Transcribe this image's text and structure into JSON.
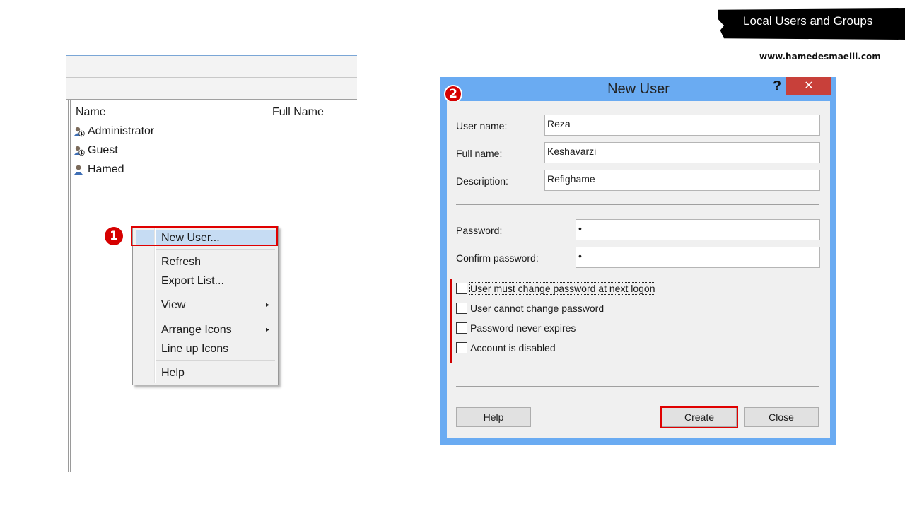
{
  "header": {
    "banner_text": "Local Users and Groups",
    "website": "www.hamedesmaeili.com"
  },
  "mmc": {
    "columns": [
      "Name",
      "Full Name"
    ],
    "users": [
      {
        "name": "Administrator",
        "icon": "user-down-icon"
      },
      {
        "name": "Guest",
        "icon": "user-down-icon"
      },
      {
        "name": "Hamed",
        "icon": "user-icon"
      }
    ]
  },
  "context_menu": {
    "step_number": "1",
    "items": {
      "new_user": "New User...",
      "refresh": "Refresh",
      "export_list": "Export List...",
      "view": "View",
      "arrange_icons": "Arrange Icons",
      "line_up_icons": "Line up Icons",
      "help": "Help"
    },
    "submenu_arrow": "▸"
  },
  "dialog": {
    "step_number": "2",
    "title": "New User",
    "help_glyph": "?",
    "close_glyph": "✕",
    "fields": {
      "user_name": {
        "label": "User name:",
        "value": "Reza"
      },
      "full_name": {
        "label": "Full name:",
        "value": "Keshavarzi"
      },
      "description": {
        "label": "Description:",
        "value": "Refighame"
      },
      "password": {
        "label": "Password:",
        "value": "•"
      },
      "confirm_password": {
        "label": "Confirm password:",
        "value": "•"
      }
    },
    "checkboxes": {
      "must_change": {
        "label": "User must change password at next logon",
        "checked": false
      },
      "cannot_change": {
        "label": "User cannot change password",
        "checked": false
      },
      "never_expires": {
        "label": "Password never expires",
        "checked": false
      },
      "disabled": {
        "label": "Account is disabled",
        "checked": false
      }
    },
    "buttons": {
      "help": "Help",
      "create": "Create",
      "close": "Close"
    }
  },
  "colors": {
    "dialog_frame": "#6aabf2",
    "close_button": "#c8403a",
    "highlight_red": "#e00000",
    "menu_highlight": "#c6dcf3"
  }
}
